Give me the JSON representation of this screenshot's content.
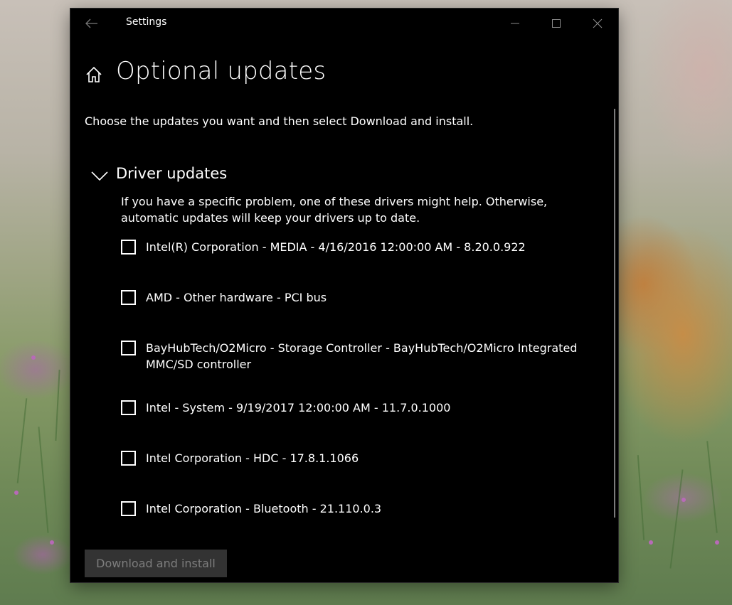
{
  "window": {
    "title": "Settings",
    "back_icon": "arrow-left-icon",
    "minimize_icon": "minimize-icon",
    "maximize_icon": "maximize-icon",
    "close_icon": "close-icon"
  },
  "page": {
    "home_icon": "home-icon",
    "title": "Optional updates",
    "intro": "Choose the updates you want and then select Download and install."
  },
  "driver_section": {
    "expanded": true,
    "chevron_icon": "chevron-down-icon",
    "title": "Driver updates",
    "description": "If you have a specific problem, one of these drivers might help. Otherwise, automatic updates will keep your drivers up to date.",
    "items": [
      {
        "label": "Intel(R) Corporation - MEDIA - 4/16/2016 12:00:00 AM - 8.20.0.922",
        "checked": false
      },
      {
        "label": "AMD - Other hardware - PCI bus",
        "checked": false
      },
      {
        "label": "BayHubTech/O2Micro - Storage Controller - BayHubTech/O2Micro Integrated MMC/SD controller",
        "checked": false
      },
      {
        "label": "Intel - System - 9/19/2017 12:00:00 AM - 11.7.0.1000",
        "checked": false
      },
      {
        "label": "Intel Corporation - HDC - 17.8.1.1066",
        "checked": false
      },
      {
        "label": "Intel Corporation - Bluetooth - 21.110.0.3",
        "checked": false
      }
    ]
  },
  "actions": {
    "download_label": "Download and install",
    "download_enabled": false
  },
  "colors": {
    "window_bg": "#000000",
    "text": "#ffffff",
    "disabled_button_bg": "#333333",
    "disabled_button_text": "#7d7d7d",
    "caption_icon": "#8a8a8a"
  }
}
